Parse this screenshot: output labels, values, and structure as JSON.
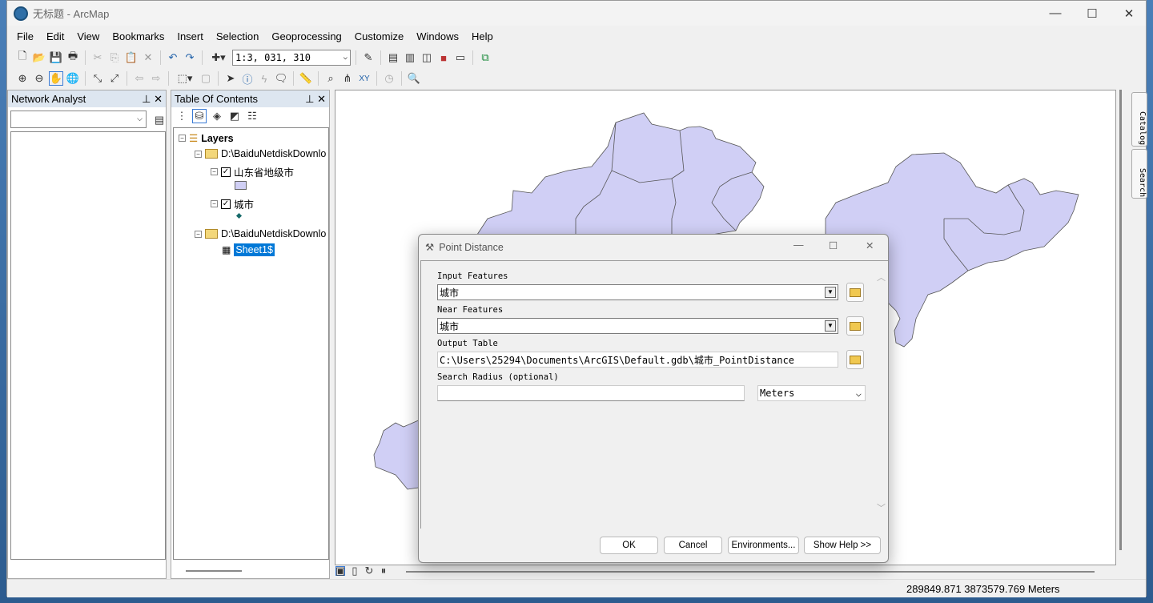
{
  "window": {
    "title": "无标题 - ArcMap",
    "minimize": "—",
    "maximize": "☐",
    "close": "✕"
  },
  "menu": [
    "File",
    "Edit",
    "View",
    "Bookmarks",
    "Insert",
    "Selection",
    "Geoprocessing",
    "Customize",
    "Windows",
    "Help"
  ],
  "toolbar": {
    "scale": "1:3, 031, 310"
  },
  "network_analyst": {
    "title": "Network Analyst",
    "pin": "📌",
    "close": "✕"
  },
  "toc": {
    "title": "Table Of Contents",
    "layers_label": "Layers",
    "groups": [
      {
        "path": "D:\\BaiduNetdiskDownlo",
        "layers": [
          {
            "name": "山东省地级市",
            "checked": true
          },
          {
            "name": "城市",
            "checked": true
          }
        ]
      },
      {
        "path": "D:\\BaiduNetdiskDownlo",
        "tables": [
          {
            "name": "Sheet1$",
            "selected": true
          }
        ]
      }
    ]
  },
  "side_tabs": [
    "Catalog",
    "Search"
  ],
  "dialog": {
    "title": "Point Distance",
    "input_features_label": "Input Features",
    "input_features_value": "城市",
    "near_features_label": "Near Features",
    "near_features_value": "城市",
    "output_table_label": "Output Table",
    "output_table_value": "C:\\Users\\25294\\Documents\\ArcGIS\\Default.gdb\\城市_PointDistance",
    "search_radius_label": "Search Radius (optional)",
    "search_radius_value": "",
    "units_value": "Meters",
    "ok": "OK",
    "cancel": "Cancel",
    "environments": "Environments...",
    "show_help": "Show Help >>"
  },
  "status": {
    "coordinates": "289849.871  3873579.769 Meters"
  },
  "colors": {
    "polygon_fill": "#d0cff5",
    "selection": "#0078d7"
  }
}
